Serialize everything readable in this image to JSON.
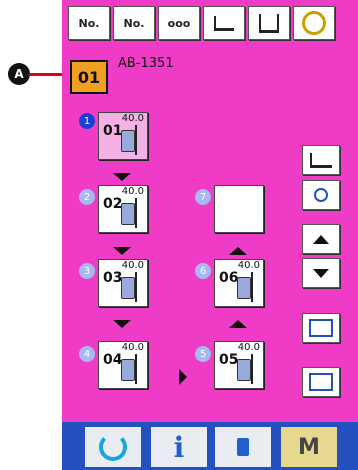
{
  "header": {
    "model": "AB-1351",
    "pattern_number": "01"
  },
  "callout": {
    "label": "A"
  },
  "toolbar": {
    "items": [
      {
        "icon": "no-edit-icon",
        "label": "No."
      },
      {
        "icon": "no-pattern-icon",
        "label": "No."
      },
      {
        "icon": "counter-icon",
        "label": "ooo"
      },
      {
        "icon": "presser-icon",
        "label": ""
      },
      {
        "icon": "needle-position-icon",
        "label": ""
      },
      {
        "icon": "bobbin-icon",
        "label": ""
      }
    ]
  },
  "steps": [
    {
      "badge": "1",
      "number": "01",
      "value": "40.0",
      "active": true
    },
    {
      "badge": "2",
      "number": "02",
      "value": "40.0",
      "active": false
    },
    {
      "badge": "3",
      "number": "03",
      "value": "40.0",
      "active": false
    },
    {
      "badge": "4",
      "number": "04",
      "value": "40.0",
      "active": false
    },
    {
      "badge": "5",
      "number": "05",
      "value": "40.0",
      "active": false
    },
    {
      "badge": "6",
      "number": "06",
      "value": "40.0",
      "active": false
    },
    {
      "badge": "7",
      "number": "",
      "value": "",
      "active": false
    }
  ],
  "colors": {
    "screen": "#ee3cc7",
    "bottom_bar": "#2450c0",
    "active_badge": "#1a3fd8",
    "idle_badge": "#a8b8f0",
    "accent_orange": "#f0a020"
  },
  "bottom_bar": {
    "mode_label": "M",
    "info_label": "i"
  }
}
